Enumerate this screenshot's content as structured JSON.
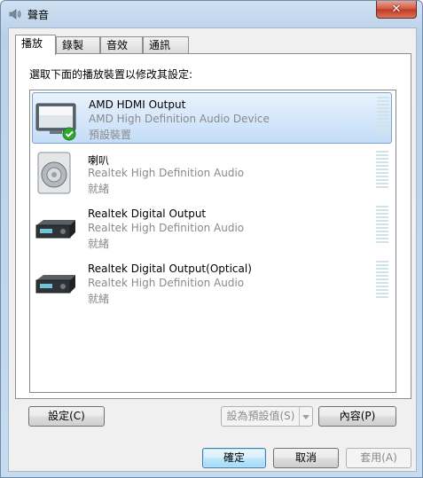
{
  "window": {
    "title": "聲音",
    "close_glyph": "✕"
  },
  "tabs": [
    {
      "label": "播放",
      "active": true
    },
    {
      "label": "錄製",
      "active": false
    },
    {
      "label": "音效",
      "active": false
    },
    {
      "label": "通訊",
      "active": false
    }
  ],
  "instruction": "選取下面的播放裝置以修改其設定:",
  "devices": [
    {
      "name": "AMD HDMI Output",
      "description": "AMD High Definition Audio Device",
      "status": "預設裝置",
      "icon": "monitor-icon",
      "selected": true,
      "default": true
    },
    {
      "name": "喇叭",
      "description": "Realtek High Definition Audio",
      "status": "就緒",
      "icon": "speaker-icon",
      "selected": false,
      "default": false
    },
    {
      "name": "Realtek Digital Output",
      "description": "Realtek High Definition Audio",
      "status": "就緒",
      "icon": "digital-output-icon",
      "selected": false,
      "default": false
    },
    {
      "name": "Realtek Digital Output(Optical)",
      "description": "Realtek High Definition Audio",
      "status": "就緒",
      "icon": "optical-output-icon",
      "selected": false,
      "default": false
    }
  ],
  "panel_buttons": {
    "configure": "設定(C)",
    "set_default": "設為預設值(S)",
    "properties": "內容(P)"
  },
  "dialog_buttons": {
    "ok": "確定",
    "cancel": "取消",
    "apply": "套用(A)"
  },
  "colors": {
    "selection": "#c4ddf8",
    "check": "#2fa82f",
    "meter": "#cfe3e8"
  }
}
